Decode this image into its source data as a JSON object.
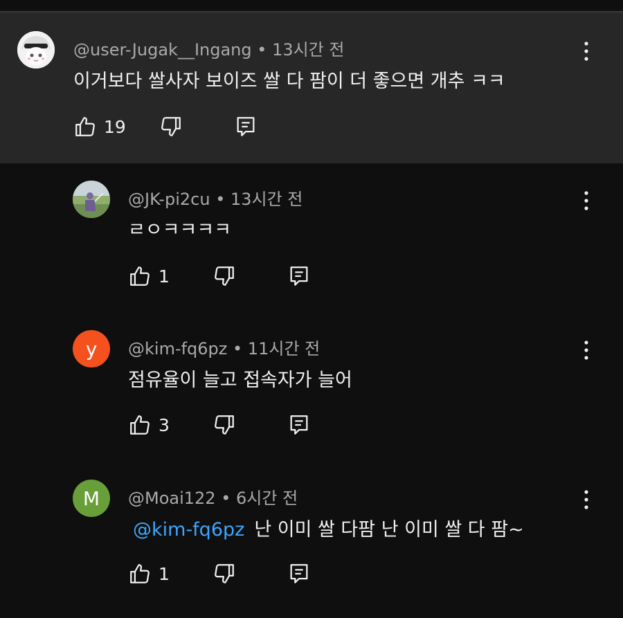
{
  "comments": [
    {
      "author": "@user-Jugak__Ingang",
      "time": "13시간 전",
      "text": "이거보다 쌀사자 보이즈 쌀 다 팜이 더 좋으면 개추 ㅋㅋ",
      "likes": "19",
      "avatar": {
        "type": "image",
        "icon": "anime-avatar"
      }
    },
    {
      "author": "@JK-pi2cu",
      "time": "13시간 전",
      "text": "ㄹㅇㅋㅋㅋㅋ",
      "likes": "1",
      "avatar": {
        "type": "image",
        "icon": "photo-avatar"
      }
    },
    {
      "author": "@kim-fq6pz",
      "time": "11시간 전",
      "text": "점유율이 늘고 접속자가 늘어",
      "likes": "3",
      "avatar": {
        "type": "letter",
        "letter": "y",
        "color": "#f4511e"
      }
    },
    {
      "author": "@Moai122",
      "time": "6시간 전",
      "mention": "@kim-fq6pz",
      "text": "난 이미 쌀 다팜 난 이미 쌀 다 팜~",
      "likes": "1",
      "avatar": {
        "type": "letter",
        "letter": "M",
        "color": "#689f38"
      }
    }
  ],
  "separator": "•",
  "colors": {
    "background": "#0f0f0f",
    "highlight": "#272727",
    "mention": "#3ea6ff",
    "meta": "#aaaaaa"
  }
}
